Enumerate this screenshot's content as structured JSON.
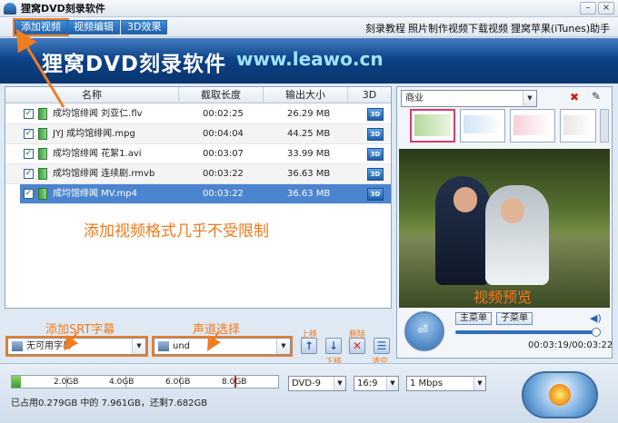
{
  "window": {
    "title": "狸窝DVD刻录软件"
  },
  "menu": {
    "tabs": [
      {
        "label": "添加视频"
      },
      {
        "label": "视频编辑"
      },
      {
        "label": "3D效果"
      }
    ],
    "links": [
      "刻录教程",
      "照片制作视频",
      "下载视频",
      "狸窝苹果(iTunes)助手"
    ]
  },
  "banner": {
    "title": "狸窝DVD刻录软件",
    "url": "www.leawo.cn"
  },
  "table": {
    "headers": {
      "name": "名称",
      "length": "截取长度",
      "size": "输出大小",
      "threed": "3D"
    },
    "rows": [
      {
        "name": "成均馆绯闻 刘亚仁.flv",
        "length": "00:02:25",
        "size": "26.29 MB"
      },
      {
        "name": "JYJ 成均馆绯闻.mpg",
        "length": "00:04:04",
        "size": "44.25 MB"
      },
      {
        "name": "成均馆绯闻 花絮1.avi",
        "length": "00:03:07",
        "size": "33.99 MB"
      },
      {
        "name": "成均馆绯闻 连续剧.rmvb",
        "length": "00:03:22",
        "size": "36.63 MB"
      },
      {
        "name": "成均馆绯闻 MV.mp4",
        "length": "00:03:22",
        "size": "36.63 MB"
      }
    ],
    "badge": "3D"
  },
  "annotations": {
    "format": "添加视频格式几乎不受限制",
    "srt": "添加SRT字幕",
    "audio": "声道选择",
    "preview": "视频预览"
  },
  "controls": {
    "subtitle_value": "无可用字幕",
    "audio_value": "und",
    "up_label": "上移",
    "down_label": "下移",
    "delete_label": "删除",
    "clear_label": "清空"
  },
  "menu_panel": {
    "template_value": "商业",
    "main_menu_label": "主菜单",
    "sub_menu_label": "子菜单",
    "time": "00:03:19/00:03:22"
  },
  "bottom": {
    "ticks": [
      "2.0GB",
      "4.0GB",
      "6.0GB",
      "8.0GB"
    ],
    "used_fraction": 0.034,
    "disc": "DVD-9",
    "ratio": "16:9",
    "bitrate": "1 Mbps",
    "status": "已占用0.279GB 中的 7.961GB，还剩7.682GB"
  },
  "colors": {
    "accent": "#ef7d22",
    "selection": "#4b84cf",
    "banner": "#0c3f82"
  }
}
